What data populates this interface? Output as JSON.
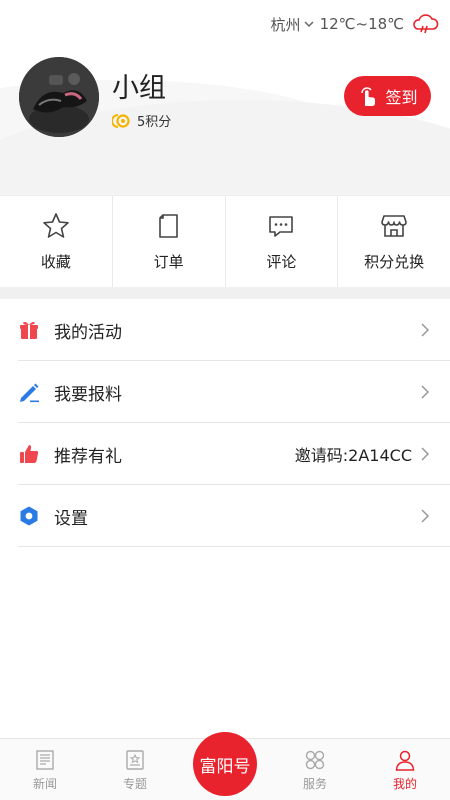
{
  "weather": {
    "city": "杭州",
    "temperature": "12℃~18℃"
  },
  "profile": {
    "username": "小组",
    "points": "5积分",
    "checkin_label": "签到"
  },
  "quick_actions": [
    {
      "label": "收藏",
      "icon": "star-icon"
    },
    {
      "label": "订单",
      "icon": "document-icon"
    },
    {
      "label": "评论",
      "icon": "comment-icon"
    },
    {
      "label": "积分兑换",
      "icon": "shop-icon"
    }
  ],
  "menu": [
    {
      "label": "我的活动",
      "icon": "gift-icon",
      "extra": ""
    },
    {
      "label": "我要报料",
      "icon": "pencil-icon",
      "extra": ""
    },
    {
      "label": "推荐有礼",
      "icon": "thumbs-up-icon",
      "extra": "邀请码:2A14CC"
    },
    {
      "label": "设置",
      "icon": "settings-hexagon-icon",
      "extra": ""
    }
  ],
  "tabbar": {
    "tabs": [
      {
        "label": "新闻",
        "icon": "newspaper-icon",
        "active": false
      },
      {
        "label": "专题",
        "icon": "topic-icon",
        "active": false
      },
      {
        "label": "服务",
        "icon": "grid-icon",
        "active": false
      },
      {
        "label": "我的",
        "icon": "person-icon",
        "active": true
      }
    ],
    "center_label": "富阳号"
  },
  "colors": {
    "accent": "#e8232d",
    "menu_icon_red": "#f0474f",
    "menu_icon_blue": "#2a7be4",
    "coin": "#f5b400"
  }
}
